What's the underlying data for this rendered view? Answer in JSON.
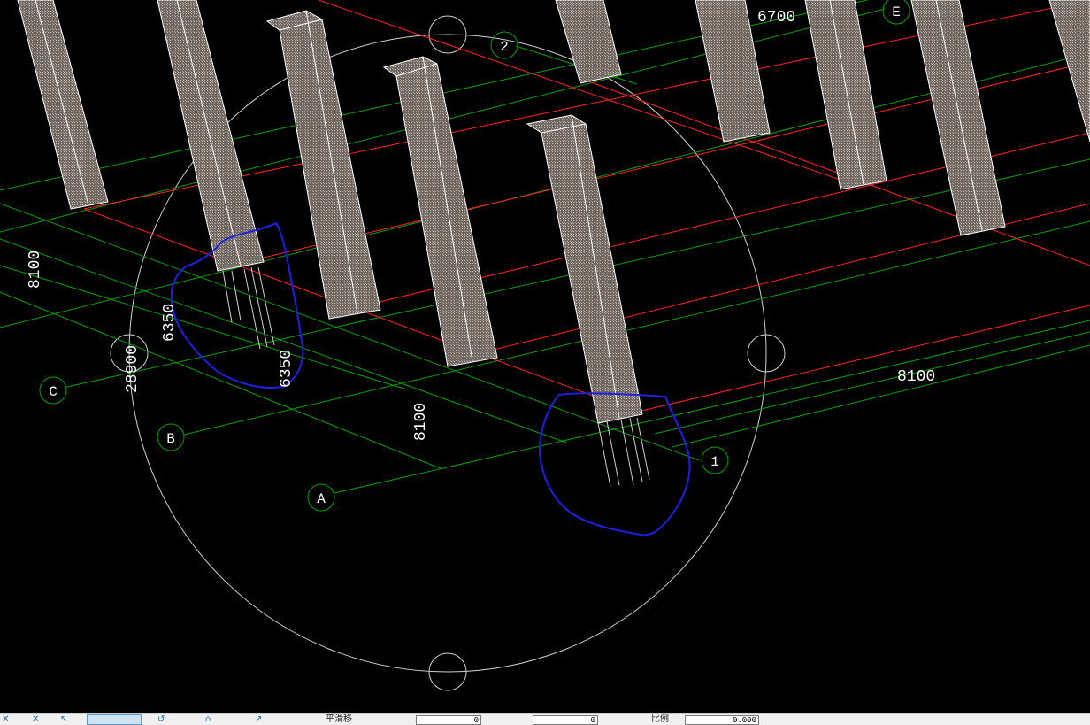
{
  "viewport": {
    "dimensions": {
      "d_6700": "6700",
      "d_8100_left": "8100",
      "d_6350_a": "6350",
      "d_6350_b": "6350",
      "d_28900": "28900",
      "d_8100_mid": "8100",
      "d_8100_right": "8100"
    },
    "grid_bubbles": {
      "b_2": "2",
      "b_E": "E",
      "b_C": "C",
      "b_B": "B",
      "b_A": "A",
      "b_1": "1"
    },
    "colors": {
      "background": "#000000",
      "axis_grid": "#00a000",
      "beam_lines": "#ff2020",
      "columns": "#ffffff",
      "column_fill": "#8a7f78",
      "markup": "#1f1fe0",
      "orbit": "#cfcfcf"
    }
  },
  "statusbar": {
    "label_1": "平滑移",
    "value_1": "0",
    "value_2": "0",
    "label_scale": "比例",
    "value_scale": "0.000"
  }
}
